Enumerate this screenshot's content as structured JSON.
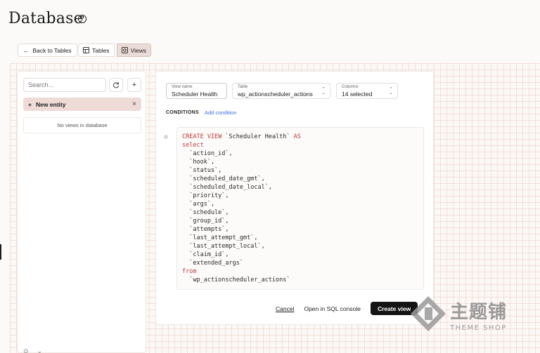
{
  "page": {
    "title": "Database"
  },
  "toolbar": {
    "back_label": "Back to Tables",
    "tabs": [
      {
        "label": "Tables",
        "active": false
      },
      {
        "label": "Views",
        "active": true
      }
    ]
  },
  "sidebar": {
    "search_placeholder": "Search...",
    "new_entity_label": "New entity",
    "empty_message": "No views in database"
  },
  "form": {
    "view_name": {
      "label": "View name",
      "value": "Scheduler Health"
    },
    "table": {
      "label": "Table",
      "value": "wp_actionscheduler_actions"
    },
    "columns": {
      "label": "Columns",
      "value": "14 selected"
    },
    "conditions_label": "CONDITIONS",
    "add_condition_label": "Add condition"
  },
  "sql": {
    "keyword_color": "#c23a3a",
    "lines": [
      [
        {
          "t": "CREATE VIEW",
          "kw": true
        },
        {
          "t": " `Scheduler Health` "
        },
        {
          "t": "AS",
          "kw": true
        }
      ],
      [
        {
          "t": "select",
          "kw": true
        }
      ],
      [
        {
          "t": "  `action_id`,"
        }
      ],
      [
        {
          "t": "  `hook`,"
        }
      ],
      [
        {
          "t": "  `status`,"
        }
      ],
      [
        {
          "t": "  `scheduled_date_gmt`,"
        }
      ],
      [
        {
          "t": "  `scheduled_date_local`,"
        }
      ],
      [
        {
          "t": "  `priority`,"
        }
      ],
      [
        {
          "t": "  `args`,"
        }
      ],
      [
        {
          "t": "  `schedule`,"
        }
      ],
      [
        {
          "t": "  `group_id`,"
        }
      ],
      [
        {
          "t": "  `attempts`,"
        }
      ],
      [
        {
          "t": "  `last_attempt_gmt`,"
        }
      ],
      [
        {
          "t": "  `last_attempt_local`,"
        }
      ],
      [
        {
          "t": "  `claim_id`,"
        }
      ],
      [
        {
          "t": "  `extended_args`"
        }
      ],
      [
        {
          "t": "from",
          "kw": true
        }
      ],
      [
        {
          "t": "  `wp_actionscheduler_actions`"
        }
      ]
    ]
  },
  "actions": {
    "cancel_label": "Cancel",
    "open_sql_label": "Open in SQL console",
    "create_label": "Create view"
  },
  "watermark": {
    "main": "主题铺",
    "sub": "THEME SHOP"
  },
  "icons": {
    "help": "help-circle-icon",
    "back": "arrow-left-icon",
    "tables": "table-icon",
    "views": "view-icon",
    "refresh": "refresh-icon",
    "add": "plus-icon",
    "close": "close-icon",
    "chevron": "chevron-updown-icon"
  }
}
